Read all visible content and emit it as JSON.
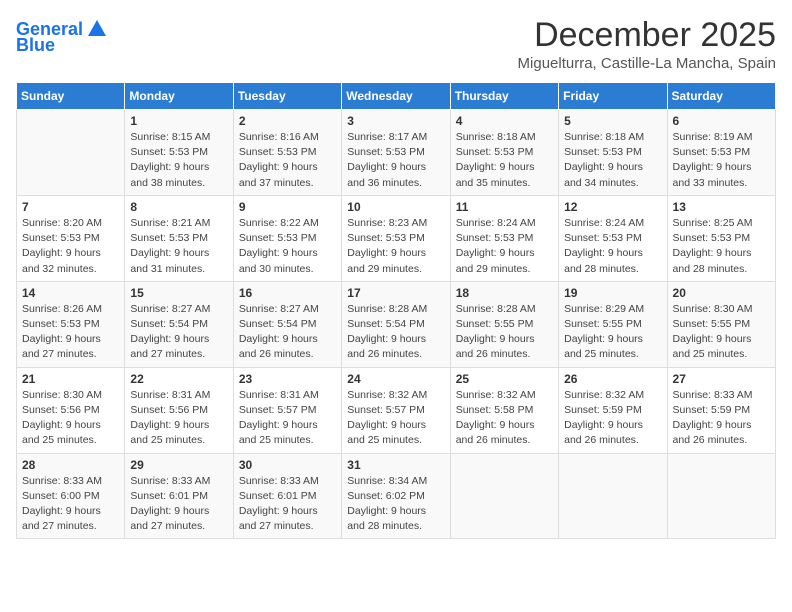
{
  "header": {
    "logo_line1": "General",
    "logo_line2": "Blue",
    "month_title": "December 2025",
    "location": "Miguelturra, Castille-La Mancha, Spain"
  },
  "weekdays": [
    "Sunday",
    "Monday",
    "Tuesday",
    "Wednesday",
    "Thursday",
    "Friday",
    "Saturday"
  ],
  "weeks": [
    [
      {
        "day": "",
        "info": ""
      },
      {
        "day": "1",
        "info": "Sunrise: 8:15 AM\nSunset: 5:53 PM\nDaylight: 9 hours\nand 38 minutes."
      },
      {
        "day": "2",
        "info": "Sunrise: 8:16 AM\nSunset: 5:53 PM\nDaylight: 9 hours\nand 37 minutes."
      },
      {
        "day": "3",
        "info": "Sunrise: 8:17 AM\nSunset: 5:53 PM\nDaylight: 9 hours\nand 36 minutes."
      },
      {
        "day": "4",
        "info": "Sunrise: 8:18 AM\nSunset: 5:53 PM\nDaylight: 9 hours\nand 35 minutes."
      },
      {
        "day": "5",
        "info": "Sunrise: 8:18 AM\nSunset: 5:53 PM\nDaylight: 9 hours\nand 34 minutes."
      },
      {
        "day": "6",
        "info": "Sunrise: 8:19 AM\nSunset: 5:53 PM\nDaylight: 9 hours\nand 33 minutes."
      }
    ],
    [
      {
        "day": "7",
        "info": "Sunrise: 8:20 AM\nSunset: 5:53 PM\nDaylight: 9 hours\nand 32 minutes."
      },
      {
        "day": "8",
        "info": "Sunrise: 8:21 AM\nSunset: 5:53 PM\nDaylight: 9 hours\nand 31 minutes."
      },
      {
        "day": "9",
        "info": "Sunrise: 8:22 AM\nSunset: 5:53 PM\nDaylight: 9 hours\nand 30 minutes."
      },
      {
        "day": "10",
        "info": "Sunrise: 8:23 AM\nSunset: 5:53 PM\nDaylight: 9 hours\nand 29 minutes."
      },
      {
        "day": "11",
        "info": "Sunrise: 8:24 AM\nSunset: 5:53 PM\nDaylight: 9 hours\nand 29 minutes."
      },
      {
        "day": "12",
        "info": "Sunrise: 8:24 AM\nSunset: 5:53 PM\nDaylight: 9 hours\nand 28 minutes."
      },
      {
        "day": "13",
        "info": "Sunrise: 8:25 AM\nSunset: 5:53 PM\nDaylight: 9 hours\nand 28 minutes."
      }
    ],
    [
      {
        "day": "14",
        "info": "Sunrise: 8:26 AM\nSunset: 5:53 PM\nDaylight: 9 hours\nand 27 minutes."
      },
      {
        "day": "15",
        "info": "Sunrise: 8:27 AM\nSunset: 5:54 PM\nDaylight: 9 hours\nand 27 minutes."
      },
      {
        "day": "16",
        "info": "Sunrise: 8:27 AM\nSunset: 5:54 PM\nDaylight: 9 hours\nand 26 minutes."
      },
      {
        "day": "17",
        "info": "Sunrise: 8:28 AM\nSunset: 5:54 PM\nDaylight: 9 hours\nand 26 minutes."
      },
      {
        "day": "18",
        "info": "Sunrise: 8:28 AM\nSunset: 5:55 PM\nDaylight: 9 hours\nand 26 minutes."
      },
      {
        "day": "19",
        "info": "Sunrise: 8:29 AM\nSunset: 5:55 PM\nDaylight: 9 hours\nand 25 minutes."
      },
      {
        "day": "20",
        "info": "Sunrise: 8:30 AM\nSunset: 5:55 PM\nDaylight: 9 hours\nand 25 minutes."
      }
    ],
    [
      {
        "day": "21",
        "info": "Sunrise: 8:30 AM\nSunset: 5:56 PM\nDaylight: 9 hours\nand 25 minutes."
      },
      {
        "day": "22",
        "info": "Sunrise: 8:31 AM\nSunset: 5:56 PM\nDaylight: 9 hours\nand 25 minutes."
      },
      {
        "day": "23",
        "info": "Sunrise: 8:31 AM\nSunset: 5:57 PM\nDaylight: 9 hours\nand 25 minutes."
      },
      {
        "day": "24",
        "info": "Sunrise: 8:32 AM\nSunset: 5:57 PM\nDaylight: 9 hours\nand 25 minutes."
      },
      {
        "day": "25",
        "info": "Sunrise: 8:32 AM\nSunset: 5:58 PM\nDaylight: 9 hours\nand 26 minutes."
      },
      {
        "day": "26",
        "info": "Sunrise: 8:32 AM\nSunset: 5:59 PM\nDaylight: 9 hours\nand 26 minutes."
      },
      {
        "day": "27",
        "info": "Sunrise: 8:33 AM\nSunset: 5:59 PM\nDaylight: 9 hours\nand 26 minutes."
      }
    ],
    [
      {
        "day": "28",
        "info": "Sunrise: 8:33 AM\nSunset: 6:00 PM\nDaylight: 9 hours\nand 27 minutes."
      },
      {
        "day": "29",
        "info": "Sunrise: 8:33 AM\nSunset: 6:01 PM\nDaylight: 9 hours\nand 27 minutes."
      },
      {
        "day": "30",
        "info": "Sunrise: 8:33 AM\nSunset: 6:01 PM\nDaylight: 9 hours\nand 27 minutes."
      },
      {
        "day": "31",
        "info": "Sunrise: 8:34 AM\nSunset: 6:02 PM\nDaylight: 9 hours\nand 28 minutes."
      },
      {
        "day": "",
        "info": ""
      },
      {
        "day": "",
        "info": ""
      },
      {
        "day": "",
        "info": ""
      }
    ]
  ]
}
